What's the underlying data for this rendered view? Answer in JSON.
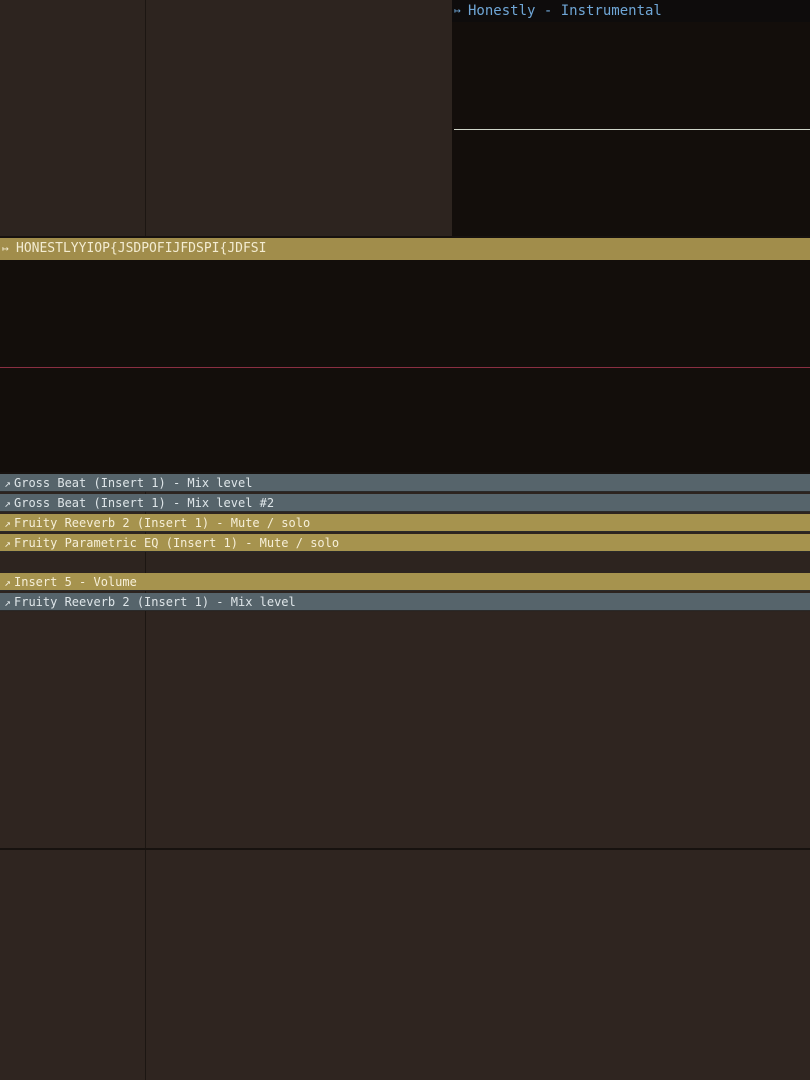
{
  "audio_clip": {
    "icon": "audio-clip-icon",
    "title": "Honestly - Instrumental",
    "header_color": "#0e0c0c",
    "title_color": "#6fa6d6",
    "level_line_color": "#cfd5c9"
  },
  "pattern_clip": {
    "icon": "pattern-clip-icon",
    "title": "HONESTLYYIOP{JSDPOFIJFDSPI{JDFSI",
    "header_color": "#a18d4b",
    "level_line_color": "#8a2f42"
  },
  "automation_clips": [
    {
      "icon": "automation-icon",
      "label": "Gross Beat (Insert 1) - Mix level",
      "color": "gray"
    },
    {
      "icon": "automation-icon",
      "label": "Gross Beat (Insert 1) - Mix level #2",
      "color": "gray"
    },
    {
      "icon": "automation-icon",
      "label": "Fruity Reeverb 2 (Insert 1) - Mute / solo",
      "color": "gold"
    },
    {
      "icon": "automation-icon",
      "label": "Fruity Parametric EQ (Insert 1) - Mute / solo",
      "color": "gold"
    },
    {
      "icon": "automation-icon",
      "label": "Insert 5 - Volume",
      "color": "gold"
    },
    {
      "icon": "automation-icon",
      "label": "Fruity Reeverb 2 (Insert 1) - Mix level",
      "color": "gray"
    }
  ],
  "colors": {
    "background": "#2d241f",
    "clip_body": "#130e0b",
    "automation_gray": "#56646b",
    "automation_gold": "#a6934e"
  }
}
